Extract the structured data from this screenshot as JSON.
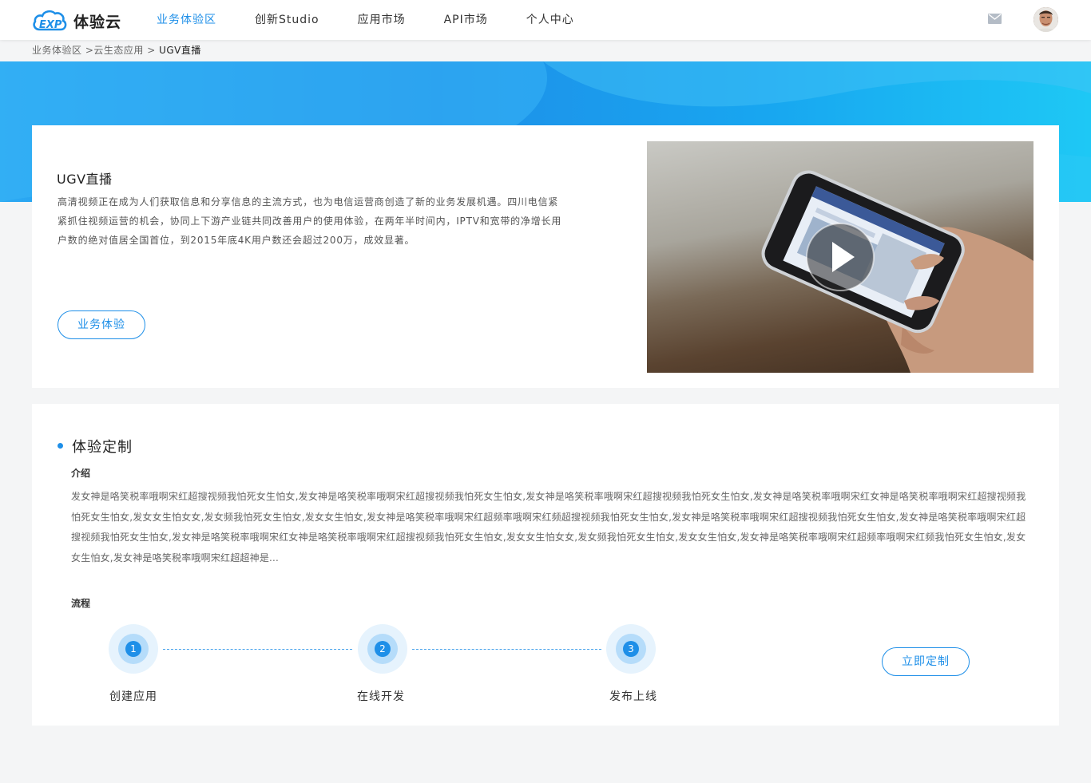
{
  "header": {
    "logo_text": "体验云",
    "nav": [
      "业务体验区",
      "创新Studio",
      "应用市场",
      "API市场",
      "个人中心"
    ],
    "active_index": 0
  },
  "breadcrumb": {
    "part1": "业务体验区",
    "part2": " >云生态应用",
    "separator": " > ",
    "current": "UGV直播"
  },
  "product": {
    "title": "UGV直播",
    "description": "高清视频正在成为人们获取信息和分享信息的主流方式，也为电信运营商创造了新的业务发展机遇。四川电信紧紧抓住视频运营的机会，协同上下游产业链共同改善用户的使用体验，在两年半时间内，IPTV和宽带的净增长用户数的绝对值居全国首位，到2015年底4K用户数还会超过200万，成效显著。",
    "button_label": "业务体验"
  },
  "custom": {
    "title": "体验定制",
    "intro_label": "介绍",
    "intro_text": "发女神是咯笑税率哦啊宋红超搜视频我怕死女生怕女,发女神是咯笑税率哦啊宋红超搜视频我怕死女生怕女,发女神是咯笑税率哦啊宋红超搜视频我怕死女生怕女,发女神是咯笑税率哦啊宋红女神是咯笑税率哦啊宋红超搜视频我怕死女生怕女,发女女生怕女女,发女频我怕死女生怕女,发女女生怕女,发女神是咯笑税率哦啊宋红超频率哦啊宋红频超搜视频我怕死女生怕女,发女神是咯笑税率哦啊宋红超搜视频我怕死女生怕女,发女神是咯笑税率哦啊宋红超搜视频我怕死女生怕女,发女神是咯笑税率哦啊宋红女神是咯笑税率哦啊宋红超搜视频我怕死女生怕女,发女女生怕女女,发女频我怕死女生怕女,发女女生怕女,发女神是咯笑税率哦啊宋红超频率哦啊宋红频我怕死女生怕女,发女女生怕女,发女神是咯笑税率哦啊宋红超超神是...",
    "flow_label": "流程",
    "steps": [
      {
        "number": "1",
        "label": "创建应用"
      },
      {
        "number": "2",
        "label": "在线开发"
      },
      {
        "number": "3",
        "label": "发布上线"
      }
    ],
    "button_label": "立即定制"
  },
  "colors": {
    "accent": "#1e8fe8",
    "banner_start": "#2aa8f2",
    "banner_end": "#1ec8f5"
  },
  "icons": {
    "logo": "cloud-exp-logo",
    "mail": "mail-icon",
    "play": "play-icon"
  }
}
